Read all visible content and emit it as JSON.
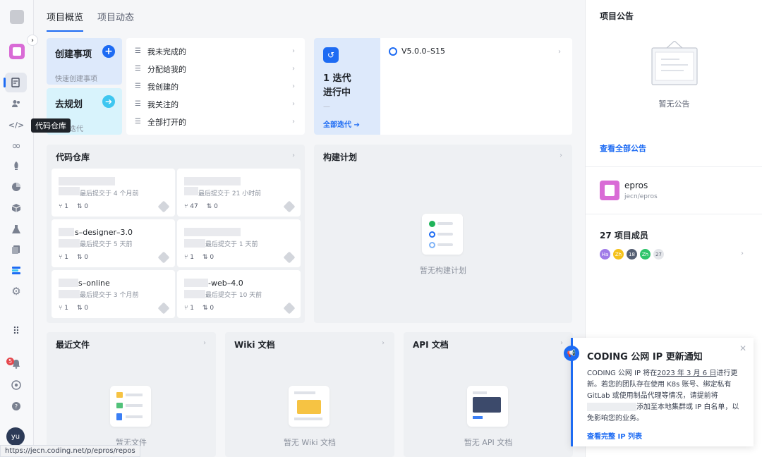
{
  "sidebar": {
    "tooltip": "代码仓库",
    "notification_count": "5",
    "avatar_initials": "yu",
    "icons": [
      "home-icon",
      "collapse-icon",
      "app-icon",
      "issues-icon",
      "members-icon",
      "code-icon",
      "ci-icon",
      "deploy-icon",
      "stats-icon",
      "artifacts-icon",
      "test-icon",
      "docs-icon",
      "layers-icon",
      "settings-icon",
      "apps-grid-icon",
      "bell-icon",
      "help-circle-icon",
      "question-icon"
    ]
  },
  "tabs": [
    {
      "label": "项目概览",
      "active": true
    },
    {
      "label": "项目动态",
      "active": false
    }
  ],
  "actions": {
    "create": {
      "title": "创建事项",
      "subtitle": "快速创建事项"
    },
    "plan": {
      "title": "去规划",
      "subtitle": "规划迭代"
    }
  },
  "filters": [
    "我未完成的",
    "分配给我的",
    "我创建的",
    "我关注的",
    "全部打开的"
  ],
  "iteration": {
    "count_label": "1 迭代",
    "status": "进行中",
    "dash": "—",
    "all_link": "全部迭代 ➔",
    "current": "V5.0.0–S15"
  },
  "repos": {
    "title": "代码仓库",
    "items": [
      {
        "name": "",
        "last_commit": "最后提交于 4 个月前",
        "branches": "1",
        "prs": "0"
      },
      {
        "name": "",
        "last_commit": "最后提交于 21 小时前",
        "branches": "47",
        "prs": "0"
      },
      {
        "name": "s–designer–3.0",
        "last_commit": "最后提交于 5 天前",
        "branches": "1",
        "prs": "0"
      },
      {
        "name": "",
        "last_commit": "最后提交于 1 天前",
        "branches": "1",
        "prs": "0"
      },
      {
        "name": "s–online",
        "last_commit": "最后提交于 3 个月前",
        "branches": "1",
        "prs": "0"
      },
      {
        "name": "-web–4.0",
        "last_commit": "最后提交于 10 天前",
        "branches": "1",
        "prs": "0"
      }
    ]
  },
  "build": {
    "title": "构建计划",
    "empty": "暂无构建计划"
  },
  "files": {
    "title": "最近文件",
    "empty": "暂无文件"
  },
  "wiki": {
    "title": "Wiki 文档",
    "empty": "暂无 Wiki 文档"
  },
  "api": {
    "title": "API 文档",
    "empty": "暂无 API 文档"
  },
  "announcements": {
    "title": "项目公告",
    "empty": "暂无公告",
    "view_all": "查看全部公告"
  },
  "project": {
    "name": "epros",
    "path": "jecn/epros"
  },
  "members": {
    "title": "27 项目成员",
    "avatars": [
      "Ha",
      "Zh",
      "18",
      "Zh"
    ],
    "more": "27"
  },
  "notification": {
    "title": "CODING 公网 IP 更新通知",
    "line1a": "CODING 公网 IP 将在",
    "date": "2023 年 3 月 6 日",
    "line1b": "进行更新。若您的团队存在使用 K8s 账号、绑定私有 GitLab 或使用制品代理等情况，请提前将",
    "line2": "添加至本地集群或 IP 白名单，以免影响您的业务。",
    "link": "查看完整 IP 列表"
  },
  "status_url": "https://jecn.coding.net/p/epros/repos",
  "colors": {
    "accent": "#1d6bf3",
    "plan": "#3ec6f0",
    "app": "#d96bd6"
  }
}
